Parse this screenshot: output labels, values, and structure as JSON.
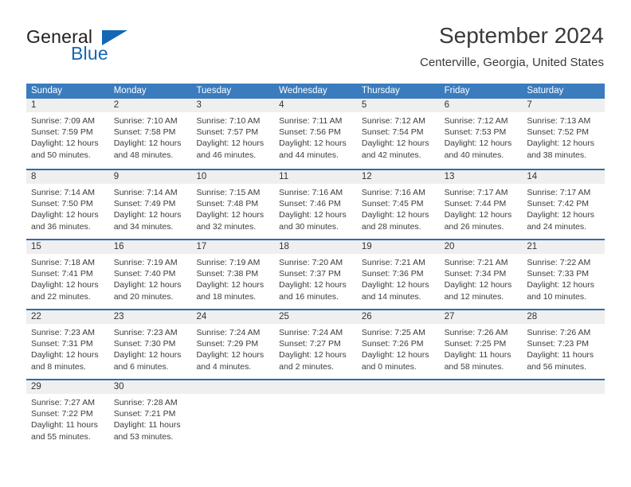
{
  "brand": {
    "name_part1": "General",
    "name_part2": "Blue",
    "logo_icon": "blue-triangle-icon",
    "accent_color": "#1268b3"
  },
  "header": {
    "title": "September 2024",
    "subtitle": "Centerville, Georgia, United States"
  },
  "theme": {
    "header_blue": "#3a7cbe",
    "divider_blue": "#2f6ea8",
    "day_band_gray": "#efefef",
    "text_color": "#3c3c3c"
  },
  "weekdays": [
    "Sunday",
    "Monday",
    "Tuesday",
    "Wednesday",
    "Thursday",
    "Friday",
    "Saturday"
  ],
  "weeks": [
    [
      {
        "day": "1",
        "sunrise": "Sunrise: 7:09 AM",
        "sunset": "Sunset: 7:59 PM",
        "daylight1": "Daylight: 12 hours",
        "daylight2": "and 50 minutes."
      },
      {
        "day": "2",
        "sunrise": "Sunrise: 7:10 AM",
        "sunset": "Sunset: 7:58 PM",
        "daylight1": "Daylight: 12 hours",
        "daylight2": "and 48 minutes."
      },
      {
        "day": "3",
        "sunrise": "Sunrise: 7:10 AM",
        "sunset": "Sunset: 7:57 PM",
        "daylight1": "Daylight: 12 hours",
        "daylight2": "and 46 minutes."
      },
      {
        "day": "4",
        "sunrise": "Sunrise: 7:11 AM",
        "sunset": "Sunset: 7:56 PM",
        "daylight1": "Daylight: 12 hours",
        "daylight2": "and 44 minutes."
      },
      {
        "day": "5",
        "sunrise": "Sunrise: 7:12 AM",
        "sunset": "Sunset: 7:54 PM",
        "daylight1": "Daylight: 12 hours",
        "daylight2": "and 42 minutes."
      },
      {
        "day": "6",
        "sunrise": "Sunrise: 7:12 AM",
        "sunset": "Sunset: 7:53 PM",
        "daylight1": "Daylight: 12 hours",
        "daylight2": "and 40 minutes."
      },
      {
        "day": "7",
        "sunrise": "Sunrise: 7:13 AM",
        "sunset": "Sunset: 7:52 PM",
        "daylight1": "Daylight: 12 hours",
        "daylight2": "and 38 minutes."
      }
    ],
    [
      {
        "day": "8",
        "sunrise": "Sunrise: 7:14 AM",
        "sunset": "Sunset: 7:50 PM",
        "daylight1": "Daylight: 12 hours",
        "daylight2": "and 36 minutes."
      },
      {
        "day": "9",
        "sunrise": "Sunrise: 7:14 AM",
        "sunset": "Sunset: 7:49 PM",
        "daylight1": "Daylight: 12 hours",
        "daylight2": "and 34 minutes."
      },
      {
        "day": "10",
        "sunrise": "Sunrise: 7:15 AM",
        "sunset": "Sunset: 7:48 PM",
        "daylight1": "Daylight: 12 hours",
        "daylight2": "and 32 minutes."
      },
      {
        "day": "11",
        "sunrise": "Sunrise: 7:16 AM",
        "sunset": "Sunset: 7:46 PM",
        "daylight1": "Daylight: 12 hours",
        "daylight2": "and 30 minutes."
      },
      {
        "day": "12",
        "sunrise": "Sunrise: 7:16 AM",
        "sunset": "Sunset: 7:45 PM",
        "daylight1": "Daylight: 12 hours",
        "daylight2": "and 28 minutes."
      },
      {
        "day": "13",
        "sunrise": "Sunrise: 7:17 AM",
        "sunset": "Sunset: 7:44 PM",
        "daylight1": "Daylight: 12 hours",
        "daylight2": "and 26 minutes."
      },
      {
        "day": "14",
        "sunrise": "Sunrise: 7:17 AM",
        "sunset": "Sunset: 7:42 PM",
        "daylight1": "Daylight: 12 hours",
        "daylight2": "and 24 minutes."
      }
    ],
    [
      {
        "day": "15",
        "sunrise": "Sunrise: 7:18 AM",
        "sunset": "Sunset: 7:41 PM",
        "daylight1": "Daylight: 12 hours",
        "daylight2": "and 22 minutes."
      },
      {
        "day": "16",
        "sunrise": "Sunrise: 7:19 AM",
        "sunset": "Sunset: 7:40 PM",
        "daylight1": "Daylight: 12 hours",
        "daylight2": "and 20 minutes."
      },
      {
        "day": "17",
        "sunrise": "Sunrise: 7:19 AM",
        "sunset": "Sunset: 7:38 PM",
        "daylight1": "Daylight: 12 hours",
        "daylight2": "and 18 minutes."
      },
      {
        "day": "18",
        "sunrise": "Sunrise: 7:20 AM",
        "sunset": "Sunset: 7:37 PM",
        "daylight1": "Daylight: 12 hours",
        "daylight2": "and 16 minutes."
      },
      {
        "day": "19",
        "sunrise": "Sunrise: 7:21 AM",
        "sunset": "Sunset: 7:36 PM",
        "daylight1": "Daylight: 12 hours",
        "daylight2": "and 14 minutes."
      },
      {
        "day": "20",
        "sunrise": "Sunrise: 7:21 AM",
        "sunset": "Sunset: 7:34 PM",
        "daylight1": "Daylight: 12 hours",
        "daylight2": "and 12 minutes."
      },
      {
        "day": "21",
        "sunrise": "Sunrise: 7:22 AM",
        "sunset": "Sunset: 7:33 PM",
        "daylight1": "Daylight: 12 hours",
        "daylight2": "and 10 minutes."
      }
    ],
    [
      {
        "day": "22",
        "sunrise": "Sunrise: 7:23 AM",
        "sunset": "Sunset: 7:31 PM",
        "daylight1": "Daylight: 12 hours",
        "daylight2": "and 8 minutes."
      },
      {
        "day": "23",
        "sunrise": "Sunrise: 7:23 AM",
        "sunset": "Sunset: 7:30 PM",
        "daylight1": "Daylight: 12 hours",
        "daylight2": "and 6 minutes."
      },
      {
        "day": "24",
        "sunrise": "Sunrise: 7:24 AM",
        "sunset": "Sunset: 7:29 PM",
        "daylight1": "Daylight: 12 hours",
        "daylight2": "and 4 minutes."
      },
      {
        "day": "25",
        "sunrise": "Sunrise: 7:24 AM",
        "sunset": "Sunset: 7:27 PM",
        "daylight1": "Daylight: 12 hours",
        "daylight2": "and 2 minutes."
      },
      {
        "day": "26",
        "sunrise": "Sunrise: 7:25 AM",
        "sunset": "Sunset: 7:26 PM",
        "daylight1": "Daylight: 12 hours",
        "daylight2": "and 0 minutes."
      },
      {
        "day": "27",
        "sunrise": "Sunrise: 7:26 AM",
        "sunset": "Sunset: 7:25 PM",
        "daylight1": "Daylight: 11 hours",
        "daylight2": "and 58 minutes."
      },
      {
        "day": "28",
        "sunrise": "Sunrise: 7:26 AM",
        "sunset": "Sunset: 7:23 PM",
        "daylight1": "Daylight: 11 hours",
        "daylight2": "and 56 minutes."
      }
    ],
    [
      {
        "day": "29",
        "sunrise": "Sunrise: 7:27 AM",
        "sunset": "Sunset: 7:22 PM",
        "daylight1": "Daylight: 11 hours",
        "daylight2": "and 55 minutes."
      },
      {
        "day": "30",
        "sunrise": "Sunrise: 7:28 AM",
        "sunset": "Sunset: 7:21 PM",
        "daylight1": "Daylight: 11 hours",
        "daylight2": "and 53 minutes."
      },
      {
        "day": "",
        "sunrise": "",
        "sunset": "",
        "daylight1": "",
        "daylight2": ""
      },
      {
        "day": "",
        "sunrise": "",
        "sunset": "",
        "daylight1": "",
        "daylight2": ""
      },
      {
        "day": "",
        "sunrise": "",
        "sunset": "",
        "daylight1": "",
        "daylight2": ""
      },
      {
        "day": "",
        "sunrise": "",
        "sunset": "",
        "daylight1": "",
        "daylight2": ""
      },
      {
        "day": "",
        "sunrise": "",
        "sunset": "",
        "daylight1": "",
        "daylight2": ""
      }
    ]
  ]
}
